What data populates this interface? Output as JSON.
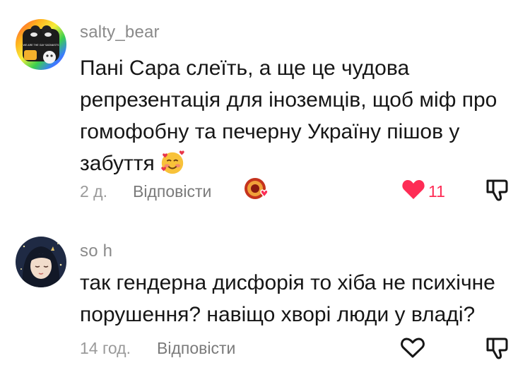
{
  "comments": [
    {
      "username": "salty_bear",
      "text_lines": [
        "Пані Сара слеїть, а ще це чудова",
        "репрезентація для іноземців, щоб міф про",
        "гомофобну та печерну Україну пішов у",
        "забуття"
      ],
      "emoji": "smiling-face-with-hearts",
      "avatar_text": "WE ARE THE GAY SATANISTS",
      "time": "2 д.",
      "reply_label": "Відповісти",
      "likes": "11",
      "liked": true,
      "creator_liked": true
    },
    {
      "username": "so h",
      "text_lines": [
        "так гендерна дисфорія то хіба не психічне",
        "порушення? навіщо хворі люди у владі?"
      ],
      "time": "14 год.",
      "reply_label": "Відповісти",
      "liked": false
    }
  ],
  "colors": {
    "like_active": "#fe2c55",
    "muted_text": "#8a8a8a",
    "body_text": "#161616"
  }
}
